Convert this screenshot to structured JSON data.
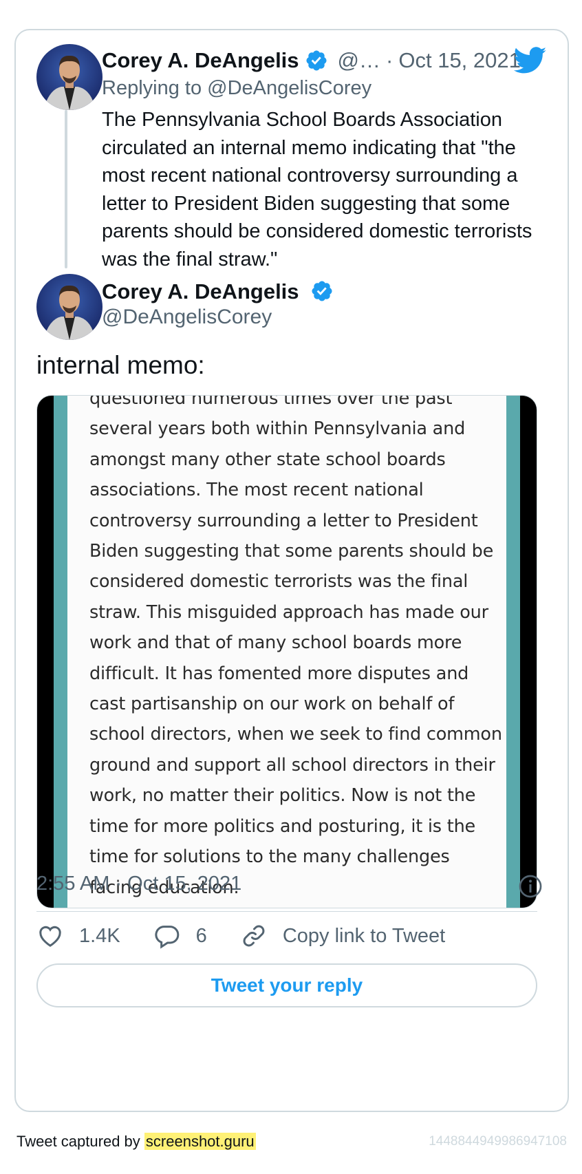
{
  "quoted_tweet": {
    "author_name": "Corey A. DeAngelis",
    "author_handle": "@…",
    "separator": "·",
    "date": "Oct 15, 2021",
    "replying_to_prefix": "Replying to",
    "replying_to_handle": "@DeAngelisCorey",
    "text": "The Pennsylvania School Boards Association circulated an internal memo indicating that \"the most recent national controversy surrounding a letter to President Biden suggesting that some parents should be considered domestic terrorists was the final straw.\""
  },
  "main_tweet": {
    "author_name": "Corey A. DeAngelis",
    "author_handle": "@DeAngelisCorey",
    "text": "internal memo:",
    "memo_text_cut": "questioned numerous times over the past",
    "memo_text": "several years both within Pennsylvania and amongst many other state school boards associations. The most recent national controversy surrounding a letter to President Biden suggesting that some parents should be considered domestic terrorists was the final straw. This misguided approach has made our work and that of many school boards more difficult. It has fomented more disputes and cast partisanship on our work on behalf of school directors, when we seek to find common ground and support all school directors in their work, no matter their politics. Now is not the time for more politics and posturing, it is the time for solutions to the many challenges facing education.",
    "timestamp": "2:55 AM · Oct 15, 2021"
  },
  "actions": {
    "likes": "1.4K",
    "replies": "6",
    "copy_link": "Copy link to Tweet"
  },
  "reply_button": "Tweet your reply",
  "footer": {
    "prefix": "Tweet captured by",
    "brand": "screenshot.guru",
    "tweet_id": "1448844949986947108"
  },
  "colors": {
    "accent": "#1d9bf0",
    "muted": "#536471",
    "border": "#cfd9de",
    "media_teal": "#5aa9ac"
  },
  "icons": [
    "verified-badge-icon",
    "twitter-bird-icon",
    "info-icon",
    "heart-icon",
    "reply-bubble-icon",
    "link-icon"
  ]
}
